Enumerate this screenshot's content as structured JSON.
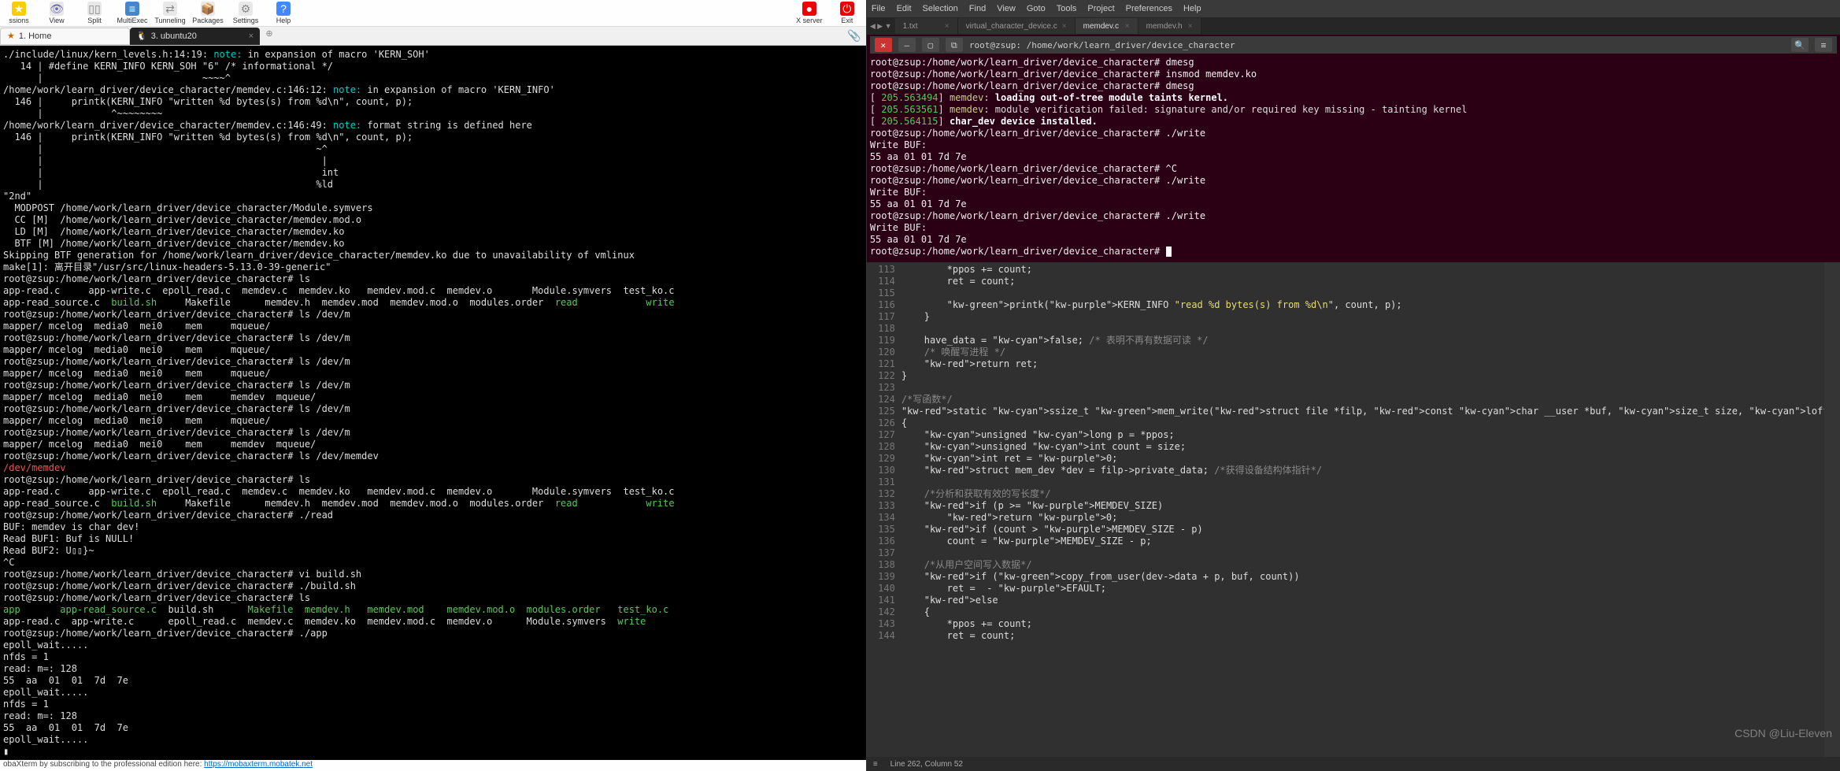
{
  "mobaxterm": {
    "toolbar": [
      {
        "name": "ssions-button",
        "label": "ssions",
        "icon": "★"
      },
      {
        "name": "view-button",
        "label": "View",
        "icon": "👁"
      },
      {
        "name": "split-button",
        "label": "Split",
        "icon": "▯▯"
      },
      {
        "name": "multiexec-button",
        "label": "MultiExec",
        "icon": "≡"
      },
      {
        "name": "tunneling-button",
        "label": "Tunneling",
        "icon": "⇄"
      },
      {
        "name": "packages-button",
        "label": "Packages",
        "icon": "📦"
      },
      {
        "name": "settings-button",
        "label": "Settings",
        "icon": "⚙"
      },
      {
        "name": "help-button",
        "label": "Help",
        "icon": "?"
      }
    ],
    "toolbar_right": [
      {
        "name": "xserver-button",
        "label": "X server",
        "icon": "●"
      },
      {
        "name": "exit-button",
        "label": "Exit",
        "icon": "⏻"
      }
    ],
    "tabs": [
      {
        "name": "tab-home",
        "label": "1. Home",
        "active": false,
        "icon": "★"
      },
      {
        "name": "tab-ubuntu",
        "label": "3. ubuntu20",
        "active": true,
        "icon": "🐧"
      }
    ],
    "terminal_lines": [
      {
        "t": "./include/linux/kern_levels.h:14:19: ",
        "a": "note:",
        "b": " in expansion of macro 'KERN_SOH'"
      },
      {
        "t": "   14 | #define KERN_INFO KERN_SOH \"6\" /* informational */"
      },
      {
        "t": "      |                            ~~~~^"
      },
      {
        "t": "/home/work/learn_driver/device_character/memdev.c:146:12: ",
        "a": "note:",
        "b": " in expansion of macro 'KERN_INFO'"
      },
      {
        "t": "  146 |     printk(KERN_INFO \"written %d bytes(s) from %d\\n\", count, p);"
      },
      {
        "t": "      |            ^~~~~~~~~"
      },
      {
        "t": "/home/work/learn_driver/device_character/memdev.c:146:49: ",
        "a": "note:",
        "b": " format string is defined here"
      },
      {
        "t": "  146 |     printk(KERN_INFO \"written %d bytes(s) from %d\\n\", count, p);"
      },
      {
        "t": "      |                                                ~^"
      },
      {
        "t": "      |                                                 |"
      },
      {
        "t": "      |                                                 int"
      },
      {
        "t": "      |                                                %ld"
      },
      {
        "t": "\"2nd\""
      },
      {
        "t": "  MODPOST /home/work/learn_driver/device_character/Module.symvers"
      },
      {
        "t": "  CC [M]  /home/work/learn_driver/device_character/memdev.mod.o"
      },
      {
        "t": "  LD [M]  /home/work/learn_driver/device_character/memdev.ko"
      },
      {
        "t": "  BTF [M] /home/work/learn_driver/device_character/memdev.ko"
      },
      {
        "t": "Skipping BTF generation for /home/work/learn_driver/device_character/memdev.ko due to unavailability of vmlinux"
      },
      {
        "t": "make[1]: 离开目录\"/usr/src/linux-headers-5.13.0-39-generic\""
      },
      {
        "t": "root@zsup:/home/work/learn_driver/device_character# ls"
      },
      {
        "t": "app-read.c     app-write.c  epoll_read.c  memdev.c  memdev.ko   memdev.mod.c  memdev.o       Module.symvers  test_ko.c"
      },
      {
        "g1": "app-read_source.c  ",
        "g2": "build.sh",
        "g3": "     Makefile      memdev.h  memdev.mod  memdev.mod.o  modules.order  ",
        "g4": "read",
        "g5": "            ",
        "g6": "write"
      },
      {
        "t": "root@zsup:/home/work/learn_driver/device_character# ls /dev/m"
      },
      {
        "t": "mapper/ mcelog  media0  mei0    mem     mqueue/"
      },
      {
        "t": "root@zsup:/home/work/learn_driver/device_character# ls /dev/m"
      },
      {
        "t": "mapper/ mcelog  media0  mei0    mem     mqueue/"
      },
      {
        "t": "root@zsup:/home/work/learn_driver/device_character# ls /dev/m"
      },
      {
        "t": "mapper/ mcelog  media0  mei0    mem     mqueue/"
      },
      {
        "t": "root@zsup:/home/work/learn_driver/device_character# ls /dev/m"
      },
      {
        "t": "mapper/ mcelog  media0  mei0    mem     memdev  mqueue/"
      },
      {
        "t": "root@zsup:/home/work/learn_driver/device_character# ls /dev/m"
      },
      {
        "t": "mapper/ mcelog  media0  mei0    mem     mqueue/"
      },
      {
        "t": "root@zsup:/home/work/learn_driver/device_character# ls /dev/m"
      },
      {
        "t": "mapper/ mcelog  media0  mei0    mem     memdev  mqueue/"
      },
      {
        "t": "root@zsup:/home/work/learn_driver/device_character# ls /dev/memdev"
      },
      {
        "r": "/dev/memdev"
      },
      {
        "t": "root@zsup:/home/work/learn_driver/device_character# ls"
      },
      {
        "t": "app-read.c     app-write.c  epoll_read.c  memdev.c  memdev.ko   memdev.mod.c  memdev.o       Module.symvers  test_ko.c"
      },
      {
        "g1": "app-read_source.c  ",
        "g2": "build.sh",
        "g3": "     Makefile      memdev.h  memdev.mod  memdev.mod.o  modules.order  ",
        "g4": "read",
        "g5": "            ",
        "g6": "write"
      },
      {
        "t": "root@zsup:/home/work/learn_driver/device_character# ./read"
      },
      {
        "t": "BUF: memdev is char dev!"
      },
      {
        "t": "Read BUF1: Buf is NULL!"
      },
      {
        "t": "Read BUF2: U▯▯}~"
      },
      {
        "t": "^C"
      },
      {
        "t": "root@zsup:/home/work/learn_driver/device_character# vi build.sh"
      },
      {
        "t": "root@zsup:/home/work/learn_driver/device_character# ./build.sh"
      },
      {
        "t": "root@zsup:/home/work/learn_driver/device_character# ls"
      },
      {
        "g1": "app",
        "g2": "       app-read_source.c  ",
        "g3": "build.sh",
        "g4": "      Makefile  memdev.h   memdev.mod    memdev.mod.o  modules.order   test_ko.c"
      },
      {
        "t": "app-read.c  app-write.c      epoll_read.c  memdev.c  memdev.ko  memdev.mod.c  memdev.o      Module.symvers  ",
        "g6": "write"
      },
      {
        "t": "root@zsup:/home/work/learn_driver/device_character# ./app"
      },
      {
        "t": "epoll_wait....."
      },
      {
        "t": "nfds = 1"
      },
      {
        "t": "read: m=: 128"
      },
      {
        "t": "55  aa  01  01  7d  7e"
      },
      {
        "t": "epoll_wait....."
      },
      {
        "t": "nfds = 1"
      },
      {
        "t": "read: m=: 128"
      },
      {
        "t": "55  aa  01  01  7d  7e"
      },
      {
        "t": "epoll_wait....."
      },
      {
        "t": "▮"
      }
    ],
    "footer_text": "obaXterm by subscribing to the professional edition here: ",
    "footer_link": "https://mobaxterm.mobatek.net"
  },
  "sublime": {
    "menu": [
      "File",
      "Edit",
      "Selection",
      "Find",
      "View",
      "Goto",
      "Tools",
      "Project",
      "Preferences",
      "Help"
    ],
    "tabs": [
      {
        "name": "tab-1txt",
        "label": "1.txt",
        "active": false
      },
      {
        "name": "tab-virtual-char",
        "label": "virtual_character_device.c",
        "active": false
      },
      {
        "name": "tab-memdev-c",
        "label": "memdev.c",
        "active": true
      },
      {
        "name": "tab-memdev-h",
        "label": "memdev.h",
        "active": false
      }
    ],
    "term_title": "root@zsup: /home/work/learn_driver/device_character",
    "term_lines": [
      "root@zsup:/home/work/learn_driver/device_character# dmesg",
      "root@zsup:/home/work/learn_driver/device_character# insmod memdev.ko",
      "root@zsup:/home/work/learn_driver/device_character# dmesg",
      "[  205.563494] memdev: loading out-of-tree module taints kernel.",
      "[  205.563561] memdev: module verification failed: signature and/or required key missing - tainting kernel",
      "[  205.564115] char_dev device installed.",
      "root@zsup:/home/work/learn_driver/device_character# ./write",
      "Write BUF:",
      "55  aa  01  01  7d  7e",
      "root@zsup:/home/work/learn_driver/device_character# ^C",
      "root@zsup:/home/work/learn_driver/device_character# ./write",
      "Write BUF:",
      "55  aa  01  01  7d  7e",
      "root@zsup:/home/work/learn_driver/device_character# ./write",
      "Write BUF:",
      "55  aa  01  01  7d  7e",
      "root@zsup:/home/work/learn_driver/device_character# "
    ],
    "code_start_line": 113,
    "code_lines": [
      "        *ppos += count;",
      "        ret = count;",
      "",
      "        printk(KERN_INFO \"read %d bytes(s) from %d\\n\", count, p);",
      "    }",
      "",
      "    have_data = false; /* 表明不再有数据可读 */",
      "    /* 唤醒写进程 */",
      "    return ret;",
      "}",
      "",
      "/*写函数*/",
      "static ssize_t mem_write(struct file *filp, const char __user *buf, size_t size, loff_t",
      "{",
      "    unsigned long p = *ppos;",
      "    unsigned int count = size;",
      "    int ret = 0;",
      "    struct mem_dev *dev = filp->private_data; /*获得设备结构体指针*/",
      "",
      "    /*分析和获取有效的写长度*/",
      "    if (p >= MEMDEV_SIZE)",
      "        return 0;",
      "    if (count > MEMDEV_SIZE - p)",
      "        count = MEMDEV_SIZE - p;",
      "",
      "    /*从用户空间写入数据*/",
      "    if (copy_from_user(dev->data + p, buf, count))",
      "        ret =  - EFAULT;",
      "    else",
      "    {",
      "        *ppos += count;",
      "        ret = count;"
    ],
    "status": "Line 262, Column 52",
    "watermark": "CSDN @Liu-Eleven"
  }
}
